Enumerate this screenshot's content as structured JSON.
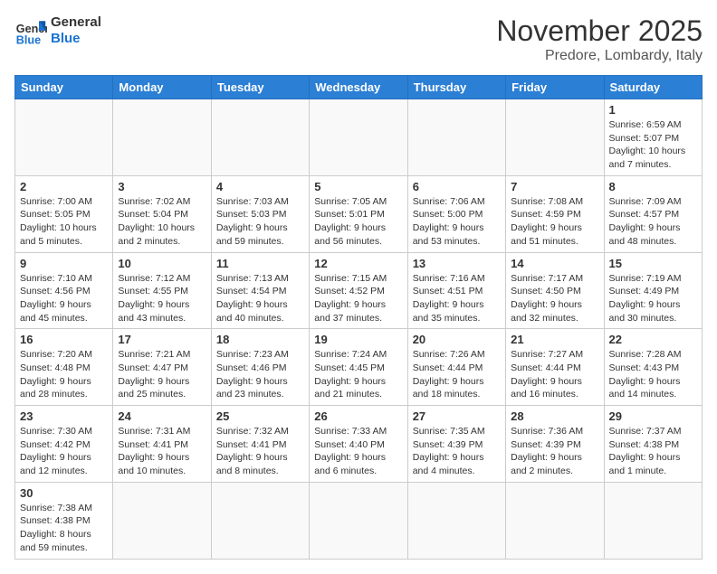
{
  "header": {
    "logo_general": "General",
    "logo_blue": "Blue",
    "month_title": "November 2025",
    "location": "Predore, Lombardy, Italy"
  },
  "days_of_week": [
    "Sunday",
    "Monday",
    "Tuesday",
    "Wednesday",
    "Thursday",
    "Friday",
    "Saturday"
  ],
  "weeks": [
    {
      "cells": [
        {
          "day": "",
          "info": ""
        },
        {
          "day": "",
          "info": ""
        },
        {
          "day": "",
          "info": ""
        },
        {
          "day": "",
          "info": ""
        },
        {
          "day": "",
          "info": ""
        },
        {
          "day": "",
          "info": ""
        },
        {
          "day": "1",
          "info": "Sunrise: 6:59 AM\nSunset: 5:07 PM\nDaylight: 10 hours and 7 minutes."
        }
      ]
    },
    {
      "cells": [
        {
          "day": "2",
          "info": "Sunrise: 7:00 AM\nSunset: 5:05 PM\nDaylight: 10 hours and 5 minutes."
        },
        {
          "day": "3",
          "info": "Sunrise: 7:02 AM\nSunset: 5:04 PM\nDaylight: 10 hours and 2 minutes."
        },
        {
          "day": "4",
          "info": "Sunrise: 7:03 AM\nSunset: 5:03 PM\nDaylight: 9 hours and 59 minutes."
        },
        {
          "day": "5",
          "info": "Sunrise: 7:05 AM\nSunset: 5:01 PM\nDaylight: 9 hours and 56 minutes."
        },
        {
          "day": "6",
          "info": "Sunrise: 7:06 AM\nSunset: 5:00 PM\nDaylight: 9 hours and 53 minutes."
        },
        {
          "day": "7",
          "info": "Sunrise: 7:08 AM\nSunset: 4:59 PM\nDaylight: 9 hours and 51 minutes."
        },
        {
          "day": "8",
          "info": "Sunrise: 7:09 AM\nSunset: 4:57 PM\nDaylight: 9 hours and 48 minutes."
        }
      ]
    },
    {
      "cells": [
        {
          "day": "9",
          "info": "Sunrise: 7:10 AM\nSunset: 4:56 PM\nDaylight: 9 hours and 45 minutes."
        },
        {
          "day": "10",
          "info": "Sunrise: 7:12 AM\nSunset: 4:55 PM\nDaylight: 9 hours and 43 minutes."
        },
        {
          "day": "11",
          "info": "Sunrise: 7:13 AM\nSunset: 4:54 PM\nDaylight: 9 hours and 40 minutes."
        },
        {
          "day": "12",
          "info": "Sunrise: 7:15 AM\nSunset: 4:52 PM\nDaylight: 9 hours and 37 minutes."
        },
        {
          "day": "13",
          "info": "Sunrise: 7:16 AM\nSunset: 4:51 PM\nDaylight: 9 hours and 35 minutes."
        },
        {
          "day": "14",
          "info": "Sunrise: 7:17 AM\nSunset: 4:50 PM\nDaylight: 9 hours and 32 minutes."
        },
        {
          "day": "15",
          "info": "Sunrise: 7:19 AM\nSunset: 4:49 PM\nDaylight: 9 hours and 30 minutes."
        }
      ]
    },
    {
      "cells": [
        {
          "day": "16",
          "info": "Sunrise: 7:20 AM\nSunset: 4:48 PM\nDaylight: 9 hours and 28 minutes."
        },
        {
          "day": "17",
          "info": "Sunrise: 7:21 AM\nSunset: 4:47 PM\nDaylight: 9 hours and 25 minutes."
        },
        {
          "day": "18",
          "info": "Sunrise: 7:23 AM\nSunset: 4:46 PM\nDaylight: 9 hours and 23 minutes."
        },
        {
          "day": "19",
          "info": "Sunrise: 7:24 AM\nSunset: 4:45 PM\nDaylight: 9 hours and 21 minutes."
        },
        {
          "day": "20",
          "info": "Sunrise: 7:26 AM\nSunset: 4:44 PM\nDaylight: 9 hours and 18 minutes."
        },
        {
          "day": "21",
          "info": "Sunrise: 7:27 AM\nSunset: 4:44 PM\nDaylight: 9 hours and 16 minutes."
        },
        {
          "day": "22",
          "info": "Sunrise: 7:28 AM\nSunset: 4:43 PM\nDaylight: 9 hours and 14 minutes."
        }
      ]
    },
    {
      "cells": [
        {
          "day": "23",
          "info": "Sunrise: 7:30 AM\nSunset: 4:42 PM\nDaylight: 9 hours and 12 minutes."
        },
        {
          "day": "24",
          "info": "Sunrise: 7:31 AM\nSunset: 4:41 PM\nDaylight: 9 hours and 10 minutes."
        },
        {
          "day": "25",
          "info": "Sunrise: 7:32 AM\nSunset: 4:41 PM\nDaylight: 9 hours and 8 minutes."
        },
        {
          "day": "26",
          "info": "Sunrise: 7:33 AM\nSunset: 4:40 PM\nDaylight: 9 hours and 6 minutes."
        },
        {
          "day": "27",
          "info": "Sunrise: 7:35 AM\nSunset: 4:39 PM\nDaylight: 9 hours and 4 minutes."
        },
        {
          "day": "28",
          "info": "Sunrise: 7:36 AM\nSunset: 4:39 PM\nDaylight: 9 hours and 2 minutes."
        },
        {
          "day": "29",
          "info": "Sunrise: 7:37 AM\nSunset: 4:38 PM\nDaylight: 9 hours and 1 minute."
        }
      ]
    },
    {
      "cells": [
        {
          "day": "30",
          "info": "Sunrise: 7:38 AM\nSunset: 4:38 PM\nDaylight: 8 hours and 59 minutes."
        },
        {
          "day": "",
          "info": ""
        },
        {
          "day": "",
          "info": ""
        },
        {
          "day": "",
          "info": ""
        },
        {
          "day": "",
          "info": ""
        },
        {
          "day": "",
          "info": ""
        },
        {
          "day": "",
          "info": ""
        }
      ]
    }
  ]
}
